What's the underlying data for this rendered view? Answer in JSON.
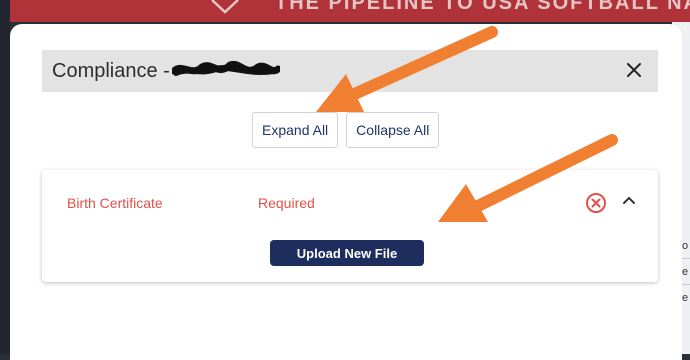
{
  "background": {
    "banner_text": "THE PIPELINE TO USA SOFTBALL NATIO",
    "banner_color": "#b0333a",
    "right_edge_letters": [
      "o",
      "e",
      "e"
    ]
  },
  "modal": {
    "title": "Compliance -",
    "title_redacted": true,
    "close_icon": "close-icon",
    "expand_all_label": "Expand All",
    "collapse_all_label": "Collapse All"
  },
  "documents": [
    {
      "name": "Birth Certificate",
      "status": "Required",
      "status_icon": "error-circle-icon",
      "expanded": true,
      "upload_label": "Upload New File"
    }
  ],
  "colors": {
    "accent_navy": "#1d2e5e",
    "error_red": "#e2504a",
    "annotation_orange": "#f07f32"
  }
}
